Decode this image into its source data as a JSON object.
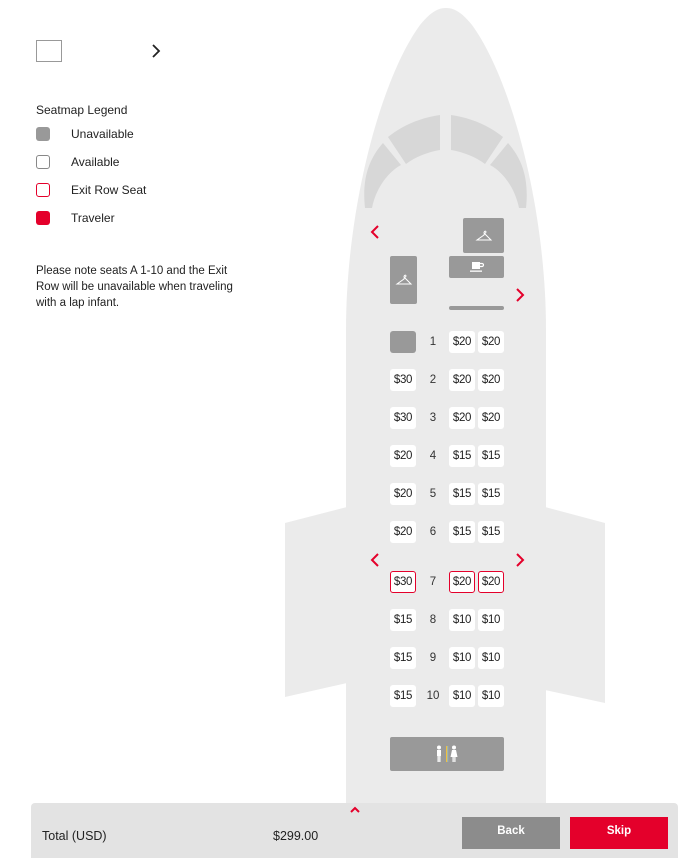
{
  "header": {
    "flight_selector_value": "",
    "next_icon": "chevron-right-icon"
  },
  "legend": {
    "title": "Seatmap Legend",
    "items": [
      {
        "key": "unavailable",
        "label": "Unavailable",
        "color": "#999999"
      },
      {
        "key": "available",
        "label": "Available",
        "color": "#ffffff"
      },
      {
        "key": "exit",
        "label": "Exit Row Seat",
        "color": "#e4002b"
      },
      {
        "key": "traveler",
        "label": "Traveler",
        "color": "#e4002b"
      }
    ]
  },
  "note": "Please note seats A 1-10 and the Exit Row will be unavailable when traveling with a lap infant.",
  "seatmap": {
    "facilities": {
      "closet_icon": "hanger-icon",
      "galley_icon": "coffee-cup-icon",
      "lavatory_icon": "restroom-icon"
    },
    "rows": [
      {
        "number": "1",
        "seats": [
          {
            "price": "",
            "status": "unavailable"
          },
          {
            "price": "$20",
            "status": "available"
          },
          {
            "price": "$20",
            "status": "available"
          }
        ]
      },
      {
        "number": "2",
        "seats": [
          {
            "price": "$30",
            "status": "available"
          },
          {
            "price": "$20",
            "status": "available"
          },
          {
            "price": "$20",
            "status": "available"
          }
        ]
      },
      {
        "number": "3",
        "seats": [
          {
            "price": "$30",
            "status": "available"
          },
          {
            "price": "$20",
            "status": "available"
          },
          {
            "price": "$20",
            "status": "available"
          }
        ]
      },
      {
        "number": "4",
        "seats": [
          {
            "price": "$20",
            "status": "available"
          },
          {
            "price": "$15",
            "status": "available"
          },
          {
            "price": "$15",
            "status": "available"
          }
        ]
      },
      {
        "number": "5",
        "seats": [
          {
            "price": "$20",
            "status": "available"
          },
          {
            "price": "$15",
            "status": "available"
          },
          {
            "price": "$15",
            "status": "available"
          }
        ]
      },
      {
        "number": "6",
        "seats": [
          {
            "price": "$20",
            "status": "available"
          },
          {
            "price": "$15",
            "status": "available"
          },
          {
            "price": "$15",
            "status": "available"
          }
        ]
      },
      {
        "number": "7",
        "seats": [
          {
            "price": "$30",
            "status": "exit"
          },
          {
            "price": "$20",
            "status": "exit"
          },
          {
            "price": "$20",
            "status": "exit"
          }
        ]
      },
      {
        "number": "8",
        "seats": [
          {
            "price": "$15",
            "status": "available"
          },
          {
            "price": "$10",
            "status": "available"
          },
          {
            "price": "$10",
            "status": "available"
          }
        ]
      },
      {
        "number": "9",
        "seats": [
          {
            "price": "$15",
            "status": "available"
          },
          {
            "price": "$10",
            "status": "available"
          },
          {
            "price": "$10",
            "status": "available"
          }
        ]
      },
      {
        "number": "10",
        "seats": [
          {
            "price": "$15",
            "status": "available"
          },
          {
            "price": "$10",
            "status": "available"
          },
          {
            "price": "$10",
            "status": "available"
          }
        ]
      }
    ]
  },
  "footer": {
    "total_label": "Total (USD)",
    "total_value": "$299.00",
    "back_label": "Back",
    "skip_label": "Skip"
  },
  "colors": {
    "accent": "#e4002b",
    "unavailable": "#999999",
    "fuselage": "#ebebeb",
    "footer_bg": "#e3e3e3",
    "back_button": "#8c8c8c"
  }
}
